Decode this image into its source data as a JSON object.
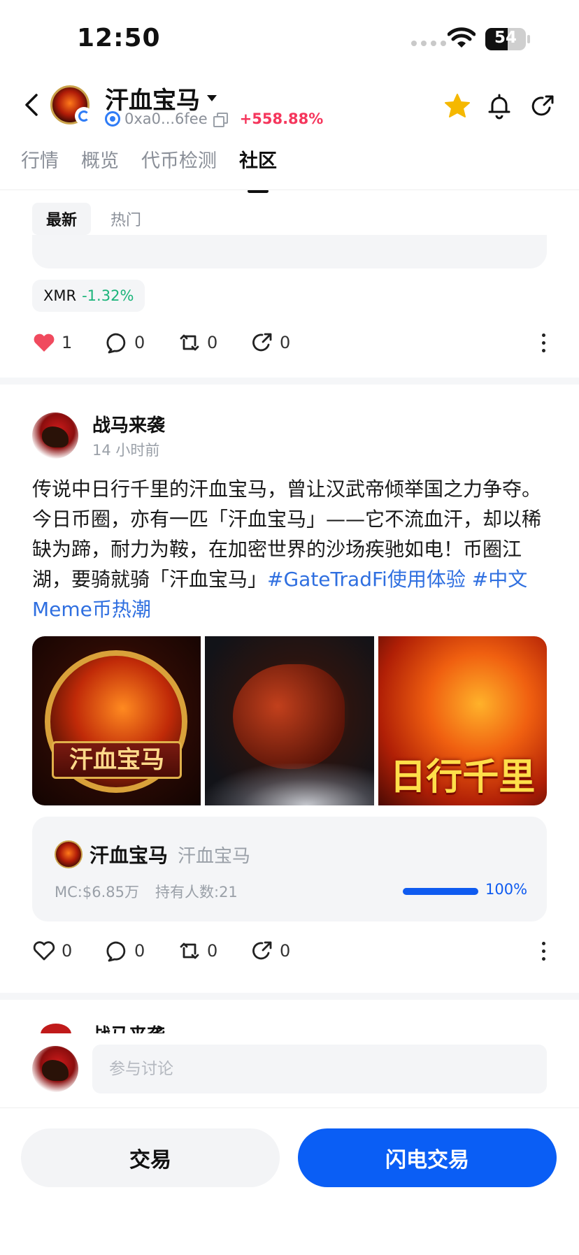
{
  "status_bar": {
    "time": "12:50",
    "battery": "54"
  },
  "header": {
    "token_name": "汗血宝马",
    "address": "0xa0...6fee",
    "change": "+558.88%"
  },
  "tabs": [
    {
      "label": "行情"
    },
    {
      "label": "概览"
    },
    {
      "label": "代币检测"
    },
    {
      "label": "社区"
    }
  ],
  "filter": {
    "latest": "最新",
    "hot": "热门"
  },
  "prev_post": {
    "tag_symbol": "XMR",
    "tag_change": "-1.32%",
    "likes": "1",
    "comments": "0",
    "reposts": "0",
    "shares": "0"
  },
  "post": {
    "author": "战马来袭",
    "time": "14 小时前",
    "body": "传说中日行千里的汗血宝马，曾让汉武帝倾举国之力争夺。今日币圈，亦有一匹「汗血宝马」——它不流血汗，却以稀缺为蹄，耐力为鞍，在加密世界的沙场疾驰如电！币圈江湖，要骑就骑「汗血宝马」",
    "tag1": "#GateTradFi使用体验",
    "tag2": "#中文Meme币热潮",
    "image_texts": [
      "汗血宝马",
      "",
      "日行千里"
    ],
    "token_card": {
      "name": "汗血宝马",
      "symbol": "汗血宝马",
      "mc": "MC:$6.85万",
      "holders": "持有人数:21",
      "progress": 100,
      "progress_label": "100%"
    },
    "likes": "0",
    "comments": "0",
    "reposts": "0",
    "shares": "0"
  },
  "next_post": {
    "author": "战马来袭"
  },
  "comment": {
    "placeholder": "参与讨论"
  },
  "buttons": {
    "trade": "交易",
    "flash_trade": "闪电交易"
  },
  "colors": {
    "accent_blue": "#0a5ef5",
    "positive": "#f5365c",
    "negative": "#1bb47a",
    "like_red": "#f04a5e",
    "star": "#f5b800"
  }
}
